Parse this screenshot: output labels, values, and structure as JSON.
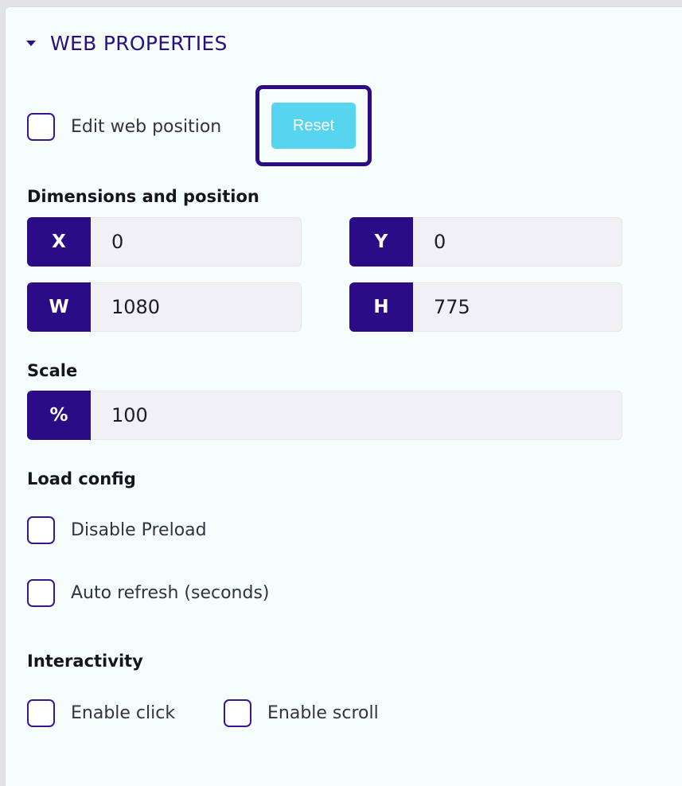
{
  "section": {
    "title": "WEB PROPERTIES",
    "caret_icon": "caret-down-icon"
  },
  "edit_position": {
    "label": "Edit web position",
    "checked": false
  },
  "reset": {
    "label": "Reset"
  },
  "dimensions": {
    "label": "Dimensions and position",
    "x": {
      "tag": "X",
      "value": "0"
    },
    "y": {
      "tag": "Y",
      "value": "0"
    },
    "w": {
      "tag": "W",
      "value": "1080"
    },
    "h": {
      "tag": "H",
      "value": "775"
    }
  },
  "scale": {
    "label": "Scale",
    "tag": "%",
    "value": "100"
  },
  "load_config": {
    "label": "Load config",
    "disable_preload": {
      "label": "Disable Preload",
      "checked": false
    },
    "auto_refresh": {
      "label": "Auto refresh (seconds)",
      "checked": false
    }
  },
  "interactivity": {
    "label": "Interactivity",
    "enable_click": {
      "label": "Enable click",
      "checked": false
    },
    "enable_scroll": {
      "label": "Enable scroll",
      "checked": false
    }
  },
  "colors": {
    "accent": "#2b0c86",
    "reset_button": "#57d4f0",
    "panel_background": "#f6fdfd"
  }
}
